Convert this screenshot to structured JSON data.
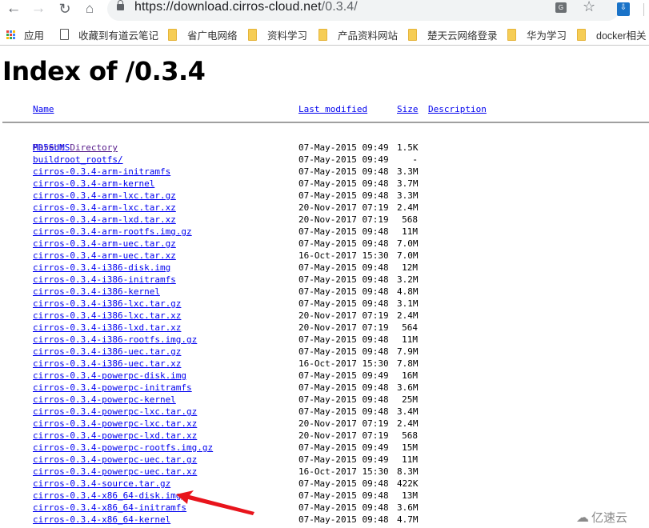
{
  "browser": {
    "url_host": "https://download.cirros-cloud.net",
    "url_path": "/0.3.4/",
    "icons": {
      "back": "back-arrow-icon",
      "forward": "forward-arrow-icon",
      "reload": "reload-icon",
      "home": "home-icon",
      "lock": "lock-icon",
      "translate": "translate-icon",
      "star": "bookmark-star-icon",
      "extension": "download-extension-icon"
    },
    "bookmarks": [
      {
        "label": "应用",
        "icon": "apps-grid-icon"
      },
      {
        "label": "收藏到有道云笔记",
        "icon": "page-icon"
      },
      {
        "label": "省广电网络",
        "icon": "folder-icon"
      },
      {
        "label": "资料学习",
        "icon": "folder-icon"
      },
      {
        "label": "产品资料网站",
        "icon": "folder-icon"
      },
      {
        "label": "楚天云网络登录",
        "icon": "folder-icon"
      },
      {
        "label": "华为学习",
        "icon": "folder-icon"
      },
      {
        "label": "docker相关",
        "icon": "folder-icon"
      }
    ]
  },
  "page": {
    "title": "Index of /0.3.4",
    "columns": {
      "name": "Name",
      "last_modified": "Last modified",
      "size": "Size",
      "description": "Description"
    },
    "parent": {
      "name": "Parent Directory",
      "date": "",
      "size": "-"
    },
    "files": [
      {
        "name": "MD5SUMS",
        "date": "07-May-2015 09:49",
        "size": "1.5K"
      },
      {
        "name": "buildroot_rootfs/",
        "date": "07-May-2015 09:49",
        "size": "-"
      },
      {
        "name": "cirros-0.3.4-arm-initramfs",
        "date": "07-May-2015 09:48",
        "size": "3.3M"
      },
      {
        "name": "cirros-0.3.4-arm-kernel",
        "date": "07-May-2015 09:48",
        "size": "3.7M"
      },
      {
        "name": "cirros-0.3.4-arm-lxc.tar.gz",
        "date": "07-May-2015 09:48",
        "size": "3.3M"
      },
      {
        "name": "cirros-0.3.4-arm-lxc.tar.xz",
        "date": "20-Nov-2017 07:19",
        "size": "2.4M"
      },
      {
        "name": "cirros-0.3.4-arm-lxd.tar.xz",
        "date": "20-Nov-2017 07:19",
        "size": "568"
      },
      {
        "name": "cirros-0.3.4-arm-rootfs.img.gz",
        "date": "07-May-2015 09:48",
        "size": "11M"
      },
      {
        "name": "cirros-0.3.4-arm-uec.tar.gz",
        "date": "07-May-2015 09:48",
        "size": "7.0M"
      },
      {
        "name": "cirros-0.3.4-arm-uec.tar.xz",
        "date": "16-Oct-2017 15:30",
        "size": "7.0M"
      },
      {
        "name": "cirros-0.3.4-i386-disk.img",
        "date": "07-May-2015 09:48",
        "size": "12M"
      },
      {
        "name": "cirros-0.3.4-i386-initramfs",
        "date": "07-May-2015 09:48",
        "size": "3.2M"
      },
      {
        "name": "cirros-0.3.4-i386-kernel",
        "date": "07-May-2015 09:48",
        "size": "4.8M"
      },
      {
        "name": "cirros-0.3.4-i386-lxc.tar.gz",
        "date": "07-May-2015 09:48",
        "size": "3.1M"
      },
      {
        "name": "cirros-0.3.4-i386-lxc.tar.xz",
        "date": "20-Nov-2017 07:19",
        "size": "2.4M"
      },
      {
        "name": "cirros-0.3.4-i386-lxd.tar.xz",
        "date": "20-Nov-2017 07:19",
        "size": "564"
      },
      {
        "name": "cirros-0.3.4-i386-rootfs.img.gz",
        "date": "07-May-2015 09:48",
        "size": "11M"
      },
      {
        "name": "cirros-0.3.4-i386-uec.tar.gz",
        "date": "07-May-2015 09:48",
        "size": "7.9M"
      },
      {
        "name": "cirros-0.3.4-i386-uec.tar.xz",
        "date": "16-Oct-2017 15:30",
        "size": "7.8M"
      },
      {
        "name": "cirros-0.3.4-powerpc-disk.img",
        "date": "07-May-2015 09:49",
        "size": "16M"
      },
      {
        "name": "cirros-0.3.4-powerpc-initramfs",
        "date": "07-May-2015 09:48",
        "size": "3.6M"
      },
      {
        "name": "cirros-0.3.4-powerpc-kernel",
        "date": "07-May-2015 09:48",
        "size": "25M"
      },
      {
        "name": "cirros-0.3.4-powerpc-lxc.tar.gz",
        "date": "07-May-2015 09:48",
        "size": "3.4M"
      },
      {
        "name": "cirros-0.3.4-powerpc-lxc.tar.xz",
        "date": "20-Nov-2017 07:19",
        "size": "2.4M"
      },
      {
        "name": "cirros-0.3.4-powerpc-lxd.tar.xz",
        "date": "20-Nov-2017 07:19",
        "size": "568"
      },
      {
        "name": "cirros-0.3.4-powerpc-rootfs.img.gz",
        "date": "07-May-2015 09:49",
        "size": "15M"
      },
      {
        "name": "cirros-0.3.4-powerpc-uec.tar.gz",
        "date": "07-May-2015 09:49",
        "size": "11M"
      },
      {
        "name": "cirros-0.3.4-powerpc-uec.tar.xz",
        "date": "16-Oct-2017 15:30",
        "size": "8.3M"
      },
      {
        "name": "cirros-0.3.4-source.tar.gz",
        "date": "07-May-2015 09:48",
        "size": "422K"
      },
      {
        "name": "cirros-0.3.4-x86_64-disk.img",
        "date": "07-May-2015 09:48",
        "size": "13M",
        "highlighted": true
      },
      {
        "name": "cirros-0.3.4-x86_64-initramfs",
        "date": "07-May-2015 09:48",
        "size": "3.6M"
      },
      {
        "name": "cirros-0.3.4-x86_64-kernel",
        "date": "07-May-2015 09:48",
        "size": "4.7M"
      }
    ]
  },
  "annotation": {
    "type": "red-arrow",
    "points_to": "cirros-0.3.4-x86_64-disk.img",
    "color": "#e8141c"
  },
  "watermark": {
    "text": "亿速云",
    "icon": "cloud-logo-icon"
  },
  "colors": {
    "link": "#0000ee",
    "visited_link": "#551a8b",
    "folder": "#f6cd55"
  }
}
